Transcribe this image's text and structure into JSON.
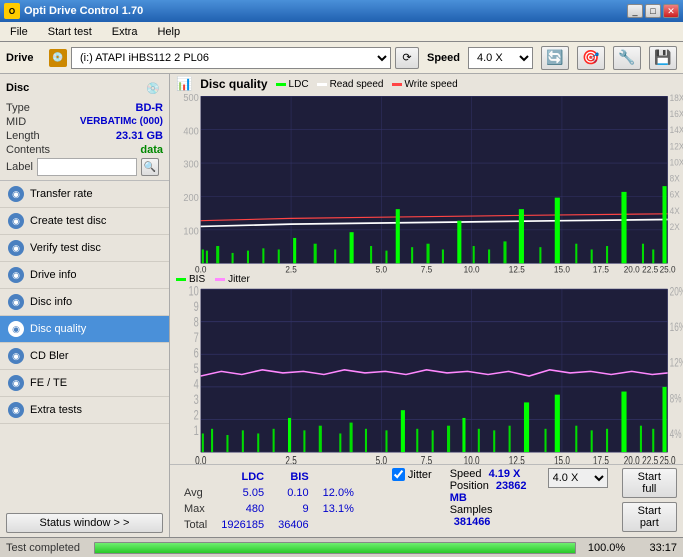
{
  "titleBar": {
    "title": "Opti Drive Control 1.70",
    "icon": "O"
  },
  "menuBar": {
    "items": [
      "File",
      "Start test",
      "Extra",
      "Help"
    ]
  },
  "driveBar": {
    "label": "Drive",
    "driveValue": "(i:)  ATAPI iHBS112  2 PL06",
    "speedLabel": "Speed",
    "speedValue": "4.0 X"
  },
  "disc": {
    "title": "Disc",
    "typeLabel": "Type",
    "typeValue": "BD-R",
    "midLabel": "MID",
    "midValue": "VERBATIMc (000)",
    "lengthLabel": "Length",
    "lengthValue": "23.31 GB",
    "contentsLabel": "Contents",
    "contentsValue": "data",
    "labelLabel": "Label"
  },
  "nav": {
    "items": [
      {
        "id": "transfer-rate",
        "label": "Transfer rate",
        "active": false
      },
      {
        "id": "create-test-disc",
        "label": "Create test disc",
        "active": false
      },
      {
        "id": "verify-test-disc",
        "label": "Verify test disc",
        "active": false
      },
      {
        "id": "drive-info",
        "label": "Drive info",
        "active": false
      },
      {
        "id": "disc-info",
        "label": "Disc info",
        "active": false
      },
      {
        "id": "disc-quality",
        "label": "Disc quality",
        "active": true
      },
      {
        "id": "cd-bler",
        "label": "CD Bler",
        "active": false
      },
      {
        "id": "fe-te",
        "label": "FE / TE",
        "active": false
      },
      {
        "id": "extra-tests",
        "label": "Extra tests",
        "active": false
      }
    ]
  },
  "statusWindowBtn": "Status window > >",
  "chartPanel": {
    "title": "Disc quality",
    "legend1": {
      "ldc": "LDC",
      "read": "Read speed",
      "write": "Write speed"
    },
    "legend2": {
      "bis": "BIS",
      "jitter": "Jitter"
    },
    "xAxisMax": "25.0 GB",
    "chart1YAxisLabels": [
      "500",
      "400",
      "300",
      "200",
      "100"
    ],
    "chart1RightLabels": [
      "18X",
      "16X",
      "14X",
      "12X",
      "10X",
      "8X",
      "6X",
      "4X",
      "2X"
    ],
    "chart2YAxisLabels": [
      "10",
      "9",
      "8",
      "7",
      "6",
      "5",
      "4",
      "3",
      "2",
      "1"
    ],
    "chart2RightLabels": [
      "20%",
      "16%",
      "12%",
      "8%",
      "4%"
    ]
  },
  "stats": {
    "rows": [
      {
        "label": "Avg",
        "ldc": "5.05",
        "bis": "0.10",
        "jitter": "12.0%"
      },
      {
        "label": "Max",
        "ldc": "480",
        "bis": "9",
        "jitter": "13.1%"
      },
      {
        "label": "Total",
        "ldc": "1926185",
        "bis": "36406",
        "jitter": ""
      }
    ],
    "headers": {
      "ldc": "LDC",
      "bis": "BIS",
      "jitter": "Jitter"
    },
    "jitterChecked": true,
    "speedLabel": "Speed",
    "speedValue": "4.19 X",
    "speedDropdown": "4.0 X",
    "positionLabel": "Position",
    "positionValue": "23862 MB",
    "samplesLabel": "Samples",
    "samplesValue": "381466",
    "startFullBtn": "Start full",
    "startPartBtn": "Start part"
  },
  "statusBar": {
    "text": "Test completed",
    "progress": "100.0%",
    "time": "33:17"
  }
}
